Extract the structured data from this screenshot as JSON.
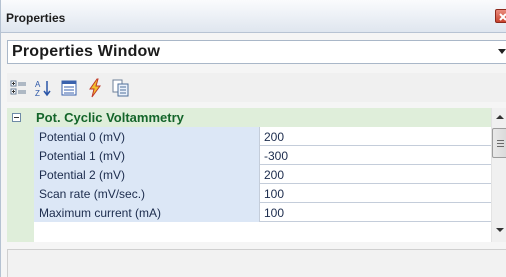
{
  "window": {
    "title": "Properties"
  },
  "selector": {
    "value": "Properties Window"
  },
  "toolbar": {
    "buttons": [
      {
        "icon": "categorized-icon"
      },
      {
        "icon": "alphabetical-sort-icon"
      },
      {
        "icon": "properties-page-icon"
      },
      {
        "icon": "events-lightning-icon"
      },
      {
        "icon": "property-pages-icon"
      }
    ]
  },
  "grid": {
    "category": "Pot. Cyclic Voltammetry",
    "category_color": "#14652a",
    "rows": [
      {
        "name": "Potential 0 (mV)",
        "value": "200"
      },
      {
        "name": "Potential 1 (mV)",
        "value": "-300"
      },
      {
        "name": "Potential 2 (mV)",
        "value": "200"
      },
      {
        "name": "Scan rate (mV/sec.)",
        "value": "100"
      },
      {
        "name": "Maximum current (mA)",
        "value": "100"
      }
    ]
  }
}
